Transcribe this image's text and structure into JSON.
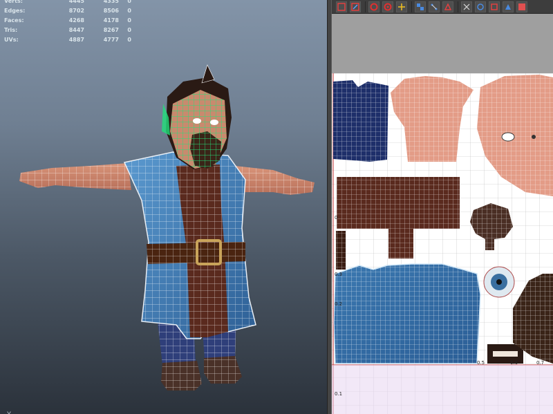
{
  "viewport": {
    "stats": [
      {
        "label": "Verts:",
        "v1": "4445",
        "v2": "4335",
        "v3": "0"
      },
      {
        "label": "Edges:",
        "v1": "8702",
        "v2": "8506",
        "v3": "0"
      },
      {
        "label": "Faces:",
        "v1": "4268",
        "v2": "4178",
        "v3": "0"
      },
      {
        "label": "Tris:",
        "v1": "8447",
        "v2": "8267",
        "v3": "0"
      },
      {
        "label": "UVs:",
        "v1": "4887",
        "v2": "4777",
        "v3": "0"
      }
    ],
    "corner_text": "Y"
  },
  "uv_editor": {
    "ticks": {
      "t0_3": "0.3",
      "t0_2": "0.2",
      "t0_1": "0.1",
      "t0_5": "0.5",
      "t0_6": "0.6",
      "t0_7": "0.7",
      "t0": "0"
    },
    "toolbar": [
      "uv-select-icon",
      "uv-move-icon",
      "isolate-icon",
      "unfold-icon",
      "align-icon",
      "grid-icon",
      "layout-icon",
      "snap-icon",
      "flip-icon",
      "rotate-icon",
      "display-icon",
      "shade-icon",
      "texture-icon",
      "more-icon"
    ]
  },
  "colors": {
    "wire": "#ffffff",
    "highlight": "#22e07a",
    "skin": "#e09a86",
    "robe": "#3f7fb8",
    "tunic": "#5a2a1e",
    "belt": "#4a2410",
    "buckle": "#c9a45a"
  }
}
